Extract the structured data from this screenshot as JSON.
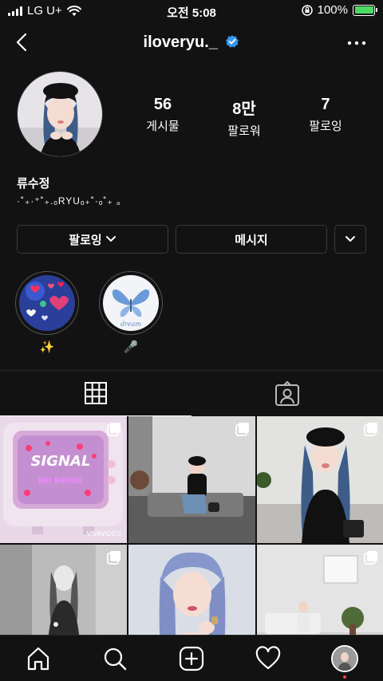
{
  "status_bar": {
    "carrier": "LG U+",
    "time": "오전 5:08",
    "battery_percent": "100%",
    "battery_level": 1.0,
    "accent_color": "#4cd964"
  },
  "header": {
    "username": "iloveryu._",
    "verified": true,
    "back_icon": "chevron-left-icon",
    "more_icon": "more-horizontal-icon"
  },
  "profile": {
    "stats": [
      {
        "value": "56",
        "label": "게시물"
      },
      {
        "value": "8만",
        "label": "팔로워"
      },
      {
        "value": "7",
        "label": "팔로잉"
      }
    ],
    "name": "류수정",
    "bio": "·˚₊·⁺˚₊.ₒRYUₒ₊˚·ₒ˚₊ 。"
  },
  "actions": {
    "following_label": "팔로잉",
    "message_label": "메시지"
  },
  "highlights": [
    {
      "label": "✨"
    },
    {
      "label": "🎤"
    }
  ],
  "tabs": [
    {
      "icon": "grid-icon",
      "active": true
    },
    {
      "icon": "tagged-icon",
      "active": false
    }
  ],
  "bottom_nav": [
    {
      "icon": "home-icon"
    },
    {
      "icon": "search-icon"
    },
    {
      "icon": "add-post-icon"
    },
    {
      "icon": "activity-heart-icon"
    },
    {
      "icon": "profile-avatar-icon"
    }
  ],
  "colors": {
    "background": "#121212",
    "verified_blue": "#3897f0",
    "notification_dot": "#ed4956"
  }
}
